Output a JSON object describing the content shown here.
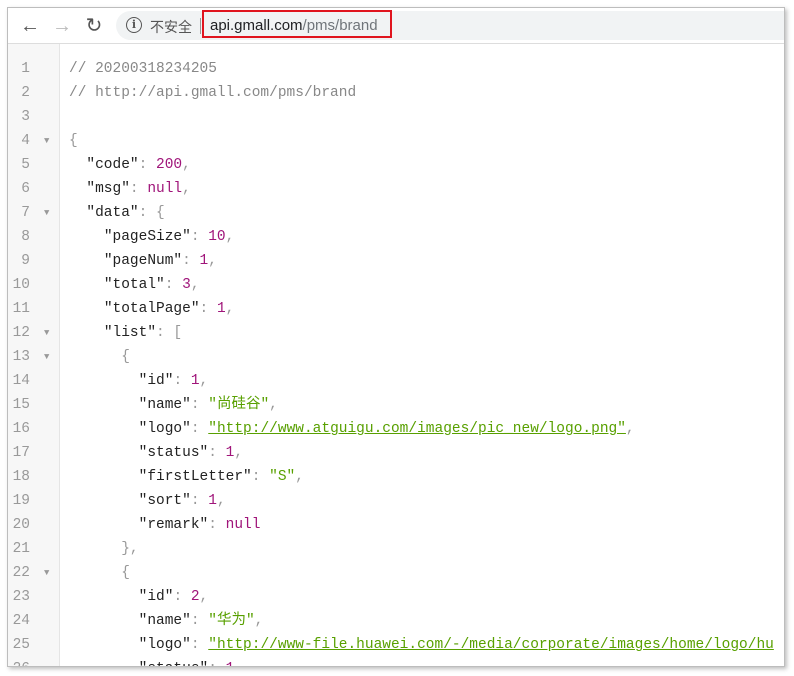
{
  "browser": {
    "insecure_label": "不安全",
    "url_host": "api.gmall.com",
    "url_path": "/pms/brand"
  },
  "lines": [
    {
      "f": false,
      "i": 0,
      "t": [
        [
          "c",
          "// 20200318234205"
        ]
      ]
    },
    {
      "f": false,
      "i": 0,
      "t": [
        [
          "c",
          "// http://api.gmall.com/pms/brand"
        ]
      ]
    },
    {
      "f": false,
      "i": 0,
      "t": []
    },
    {
      "f": true,
      "i": 0,
      "t": [
        [
          "p",
          "{"
        ]
      ]
    },
    {
      "f": false,
      "i": 1,
      "t": [
        [
          "k",
          "\"code\""
        ],
        [
          "p",
          ": "
        ],
        [
          "n",
          "200"
        ],
        [
          "p",
          ","
        ]
      ]
    },
    {
      "f": false,
      "i": 1,
      "t": [
        [
          "k",
          "\"msg\""
        ],
        [
          "p",
          ": "
        ],
        [
          "n",
          "null"
        ],
        [
          "p",
          ","
        ]
      ]
    },
    {
      "f": true,
      "i": 1,
      "t": [
        [
          "k",
          "\"data\""
        ],
        [
          "p",
          ": {"
        ]
      ]
    },
    {
      "f": false,
      "i": 2,
      "t": [
        [
          "k",
          "\"pageSize\""
        ],
        [
          "p",
          ": "
        ],
        [
          "n",
          "10"
        ],
        [
          "p",
          ","
        ]
      ]
    },
    {
      "f": false,
      "i": 2,
      "t": [
        [
          "k",
          "\"pageNum\""
        ],
        [
          "p",
          ": "
        ],
        [
          "n",
          "1"
        ],
        [
          "p",
          ","
        ]
      ]
    },
    {
      "f": false,
      "i": 2,
      "t": [
        [
          "k",
          "\"total\""
        ],
        [
          "p",
          ": "
        ],
        [
          "n",
          "3"
        ],
        [
          "p",
          ","
        ]
      ]
    },
    {
      "f": false,
      "i": 2,
      "t": [
        [
          "k",
          "\"totalPage\""
        ],
        [
          "p",
          ": "
        ],
        [
          "n",
          "1"
        ],
        [
          "p",
          ","
        ]
      ]
    },
    {
      "f": true,
      "i": 2,
      "t": [
        [
          "k",
          "\"list\""
        ],
        [
          "p",
          ": ["
        ]
      ]
    },
    {
      "f": true,
      "i": 3,
      "t": [
        [
          "p",
          "{"
        ]
      ]
    },
    {
      "f": false,
      "i": 4,
      "t": [
        [
          "k",
          "\"id\""
        ],
        [
          "p",
          ": "
        ],
        [
          "n",
          "1"
        ],
        [
          "p",
          ","
        ]
      ]
    },
    {
      "f": false,
      "i": 4,
      "t": [
        [
          "k",
          "\"name\""
        ],
        [
          "p",
          ": "
        ],
        [
          "s",
          "\"尚硅谷\""
        ],
        [
          "p",
          ","
        ]
      ]
    },
    {
      "f": false,
      "i": 4,
      "t": [
        [
          "k",
          "\"logo\""
        ],
        [
          "p",
          ": "
        ],
        [
          "u",
          "\"http://www.atguigu.com/images/pic_new/logo.png\""
        ],
        [
          "p",
          ","
        ]
      ]
    },
    {
      "f": false,
      "i": 4,
      "t": [
        [
          "k",
          "\"status\""
        ],
        [
          "p",
          ": "
        ],
        [
          "n",
          "1"
        ],
        [
          "p",
          ","
        ]
      ]
    },
    {
      "f": false,
      "i": 4,
      "t": [
        [
          "k",
          "\"firstLetter\""
        ],
        [
          "p",
          ": "
        ],
        [
          "s",
          "\"S\""
        ],
        [
          "p",
          ","
        ]
      ]
    },
    {
      "f": false,
      "i": 4,
      "t": [
        [
          "k",
          "\"sort\""
        ],
        [
          "p",
          ": "
        ],
        [
          "n",
          "1"
        ],
        [
          "p",
          ","
        ]
      ]
    },
    {
      "f": false,
      "i": 4,
      "t": [
        [
          "k",
          "\"remark\""
        ],
        [
          "p",
          ": "
        ],
        [
          "n",
          "null"
        ]
      ]
    },
    {
      "f": false,
      "i": 3,
      "t": [
        [
          "p",
          "},"
        ]
      ]
    },
    {
      "f": true,
      "i": 3,
      "t": [
        [
          "p",
          "{"
        ]
      ]
    },
    {
      "f": false,
      "i": 4,
      "t": [
        [
          "k",
          "\"id\""
        ],
        [
          "p",
          ": "
        ],
        [
          "n",
          "2"
        ],
        [
          "p",
          ","
        ]
      ]
    },
    {
      "f": false,
      "i": 4,
      "t": [
        [
          "k",
          "\"name\""
        ],
        [
          "p",
          ": "
        ],
        [
          "s",
          "\"华为\""
        ],
        [
          "p",
          ","
        ]
      ]
    },
    {
      "f": false,
      "i": 4,
      "t": [
        [
          "k",
          "\"logo\""
        ],
        [
          "p",
          ": "
        ],
        [
          "u",
          "\"http://www-file.huawei.com/-/media/corporate/images/home/logo/hu"
        ]
      ]
    },
    {
      "f": false,
      "i": 4,
      "t": [
        [
          "k",
          "\"status\""
        ],
        [
          "p",
          ": "
        ],
        [
          "n",
          "1"
        ]
      ]
    }
  ]
}
